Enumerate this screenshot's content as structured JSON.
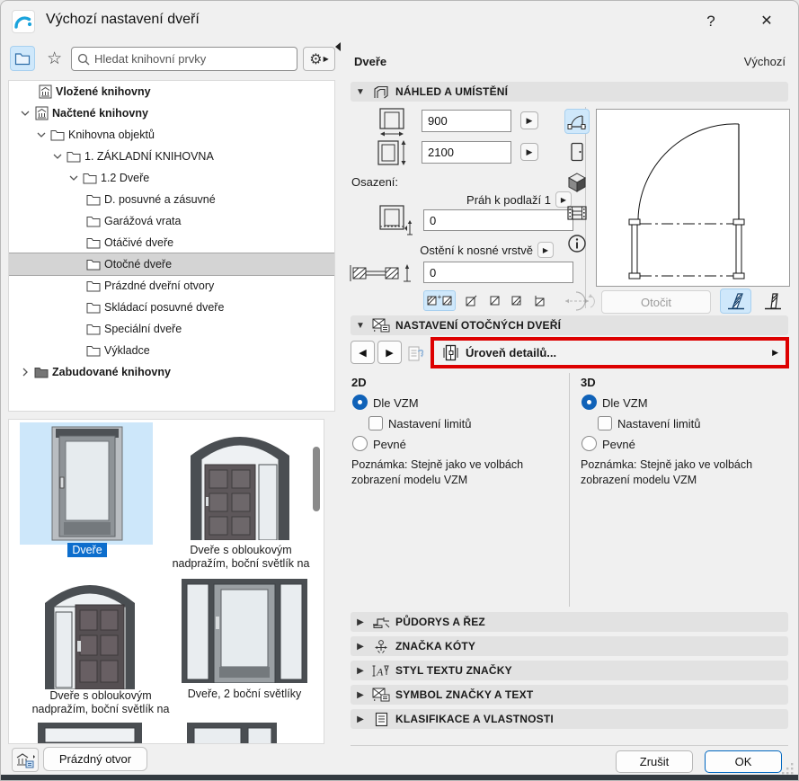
{
  "colors": {
    "accent_blue": "#1062b8",
    "selection_light_blue": "#cfe8fb",
    "annotation_red": "#dd0000",
    "ok_button_border": "#0067c0"
  },
  "window": {
    "title": "Výchozí nastavení dveří",
    "help_label": "?",
    "close_label": "✕"
  },
  "library_panel": {
    "search_placeholder": "Hledat knihovní prvky",
    "tree": [
      {
        "label": "Vložené knihovny"
      },
      {
        "label": "Načtené knihovny"
      },
      {
        "label": "Knihovna objektů"
      },
      {
        "label": "1. ZÁKLADNÍ KNIHOVNA"
      },
      {
        "label": "1.2 Dveře"
      },
      {
        "label": "D. posuvné a zásuvné"
      },
      {
        "label": "Garážová vrata"
      },
      {
        "label": "Otáčivé dveře"
      },
      {
        "label": "Otočné dveře"
      },
      {
        "label": "Prázdné dveřní otvory"
      },
      {
        "label": "Skládací posuvné dveře"
      },
      {
        "label": "Speciální dveře"
      },
      {
        "label": "Výkladce"
      },
      {
        "label": "Zabudované knihovny"
      }
    ],
    "thumbnails": [
      {
        "label": "Dveře"
      },
      {
        "label": "Dveře s obloukovým nadpražím, boční světlík na ..."
      },
      {
        "label": "Dveře s obloukovým nadpražím, boční světlík na ..."
      },
      {
        "label": "Dveře, 2 boční světlíky"
      }
    ],
    "empty_opening_label": "Prázdný otvor"
  },
  "header": {
    "element_type": "Dveře",
    "default_label": "Výchozí"
  },
  "preview": {
    "section_title": "NÁHLED A UMÍSTĚNÍ",
    "width_value": "900",
    "height_value": "2100",
    "anchor_group_label": "Osazení:",
    "sill_label": "Práh k podlaží 1",
    "sill_value": "0",
    "reveal_label": "Ostění k nosné vrstvě",
    "reveal_value": "0",
    "rotate_button": "Otočit"
  },
  "door_settings": {
    "section_title": "NASTAVENÍ OTOČNÝCH DVEŘÍ",
    "detail_level_label": "Úroveň detailů..."
  },
  "model_view_options": {
    "col_2d": {
      "title": "2D",
      "radio_mvo": "Dle VZM",
      "checkbox_limits": "Nastavení limitů",
      "radio_fixed": "Pevné",
      "note": "Poznámka: Stejně jako ve volbách zobrazení modelu VZM"
    },
    "col_3d": {
      "title": "3D",
      "radio_mvo": "Dle VZM",
      "checkbox_limits": "Nastavení limitů",
      "radio_fixed": "Pevné",
      "note": "Poznámka: Stejně jako ve volbách zobrazení modelu VZM"
    }
  },
  "collapsed_sections": [
    {
      "label": "PŮDORYS A ŘEZ"
    },
    {
      "label": "ZNAČKA KÓTY"
    },
    {
      "label": "STYL TEXTU ZNAČKY"
    },
    {
      "label": "SYMBOL ZNAČKY A TEXT"
    },
    {
      "label": "KLASIFIKACE A VLASTNOSTI"
    }
  ],
  "footer": {
    "cancel_label": "Zrušit",
    "ok_label": "OK"
  }
}
